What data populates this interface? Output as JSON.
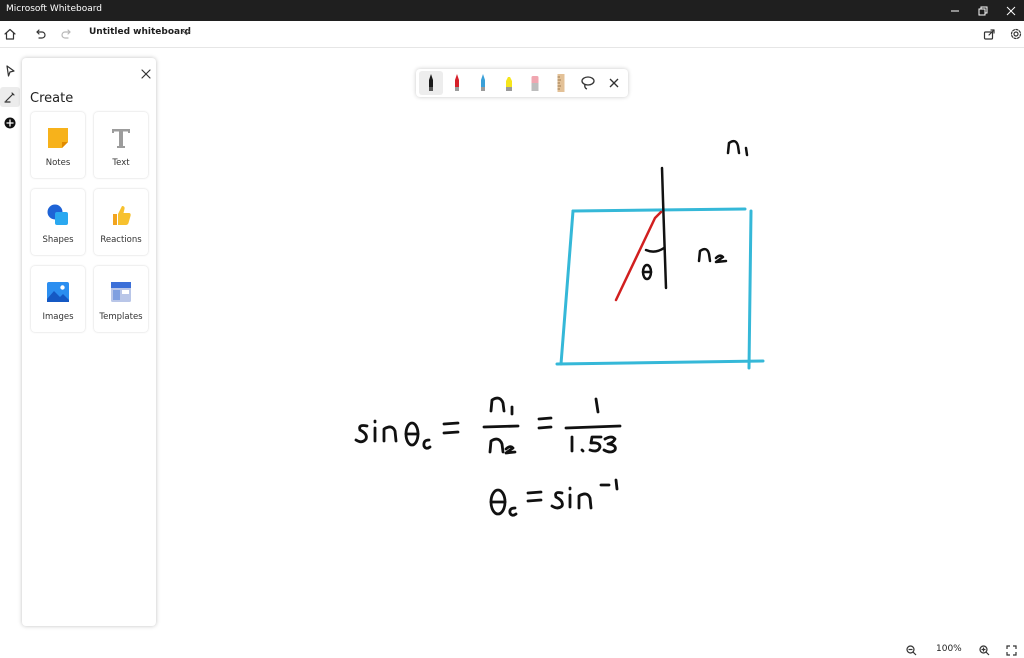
{
  "app": {
    "title": "Microsoft Whiteboard"
  },
  "appbar": {
    "board_title": "Untitled whiteboard"
  },
  "create_panel": {
    "title": "Create",
    "tiles": [
      {
        "label": "Notes",
        "icon": "sticky-note-icon"
      },
      {
        "label": "Text",
        "icon": "text-icon"
      },
      {
        "label": "Shapes",
        "icon": "shapes-icon"
      },
      {
        "label": "Reactions",
        "icon": "thumbs-up-icon"
      },
      {
        "label": "Images",
        "icon": "image-icon"
      },
      {
        "label": "Templates",
        "icon": "templates-icon"
      }
    ]
  },
  "ink_toolbar": {
    "tools": [
      "black-pen",
      "red-pen",
      "blue-pen",
      "yellow-highlighter",
      "eraser",
      "ruler",
      "lasso",
      "close"
    ],
    "colors": {
      "black": "#1a1a1a",
      "red": "#d6202a",
      "blue": "#3aa0d8",
      "yellow": "#f5e51b",
      "eraser": "#f0a6b0",
      "ruler": "#d9b48a"
    }
  },
  "canvas": {
    "ink_colors": {
      "black": "#111111",
      "red": "#d11f1f",
      "cyan": "#35b8d8"
    }
  },
  "zoom": {
    "level": "100%"
  }
}
